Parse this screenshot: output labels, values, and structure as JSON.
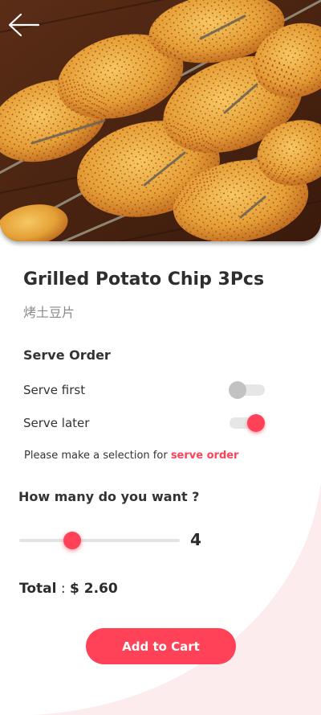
{
  "product": {
    "name": "Grilled Potato Chip 3Pcs",
    "name_cn": "烤土豆片"
  },
  "serve_order": {
    "heading": "Serve Order",
    "options": [
      {
        "label": "Serve first",
        "state": "off"
      },
      {
        "label": "Serve later",
        "state": "on"
      }
    ],
    "note_prefix": "Please make a selection for ",
    "note_highlight": "serve order"
  },
  "quantity": {
    "question": "How many do you want ?",
    "value": "4",
    "slider_fraction": 0.33
  },
  "total": {
    "label": "Total",
    "separator": " : ",
    "amount": "$ 2.60"
  },
  "add_to_cart_label": "Add to Cart",
  "colors": {
    "accent": "#ff4257",
    "background_curve": "#fdecee"
  },
  "icons": {
    "back": "arrow-left-icon"
  }
}
